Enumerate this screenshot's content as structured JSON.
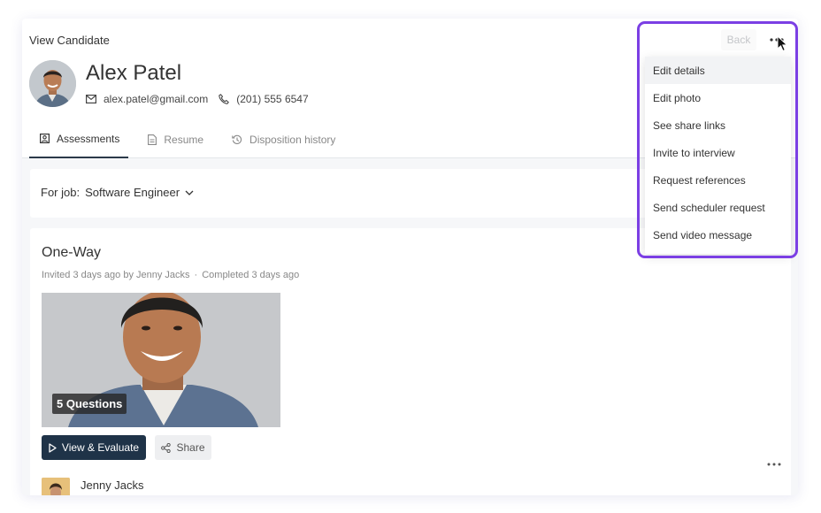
{
  "page": {
    "label": "View Candidate"
  },
  "candidate": {
    "name": "Alex Patel",
    "email": "alex.patel@gmail.com",
    "phone": "(201) 555 6547"
  },
  "tabs": [
    {
      "label": "Assessments",
      "icon": "user-square-icon",
      "active": true
    },
    {
      "label": "Resume",
      "icon": "document-icon",
      "active": false
    },
    {
      "label": "Disposition history",
      "icon": "history-icon",
      "active": false
    }
  ],
  "job": {
    "prefix": "For job:",
    "name": "Software Engineer"
  },
  "assessment": {
    "title": "One-Way",
    "invited": "Invited 3 days ago by Jenny Jacks",
    "separator": "·",
    "completed": "Completed 3 days ago",
    "questions_badge": "5 Questions",
    "evaluate_label": "View & Evaluate",
    "share_label": "Share",
    "evaluator": "Jenny Jacks"
  },
  "toolbar": {
    "back_label": "Back"
  },
  "menu": {
    "items": [
      "Edit details",
      "Edit photo",
      "See share links",
      "Invite to interview",
      "Request references",
      "Send scheduler request",
      "Send video message"
    ],
    "hovered_index": 0
  },
  "colors": {
    "accent": "#7b3fe4",
    "primary_button": "#1f3348",
    "text": "#333333",
    "muted": "#888888"
  }
}
